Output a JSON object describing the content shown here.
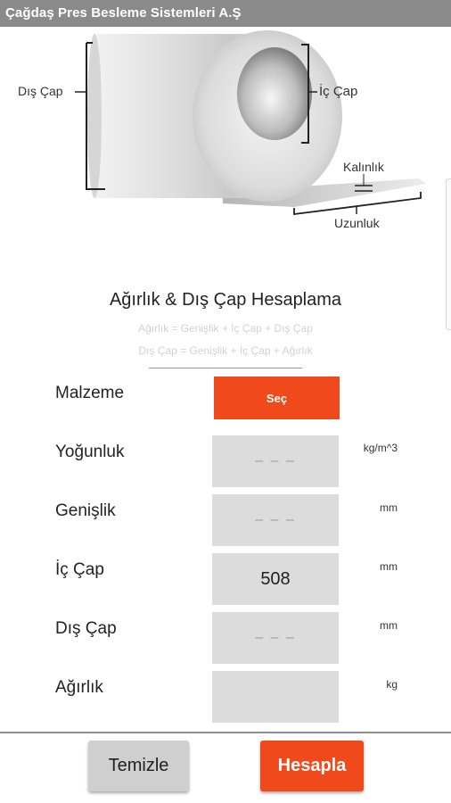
{
  "app": {
    "title": "Çağdaş Pres Besleme Sistemleri A.Ş"
  },
  "diagram": {
    "outer_diameter_label": "Dış Çap",
    "inner_diameter_label": "İç Çap",
    "thickness_label": "Kalınlık",
    "length_label": "Uzunluk"
  },
  "section": {
    "title": "Ağırlık & Dış Çap Hesaplama",
    "formula_1": "Ağırlık = Genişlik + İç Çap + Dış Çap",
    "formula_2": "Dış Çap = Genişlik + İç Çap + Ağırlık"
  },
  "form": {
    "material": {
      "label": "Malzeme",
      "button": "Seç"
    },
    "density": {
      "label": "Yoğunluk",
      "value": "",
      "placeholder": "– – –",
      "unit": "kg/m^3"
    },
    "width": {
      "label": "Genişlik",
      "value": "",
      "placeholder": "– – –",
      "unit": "mm"
    },
    "inner_diameter": {
      "label": "İç Çap",
      "value": "508",
      "placeholder": "– – –",
      "unit": "mm"
    },
    "outer_diameter": {
      "label": "Dış Çap",
      "value": "",
      "placeholder": "– – –",
      "unit": "mm"
    },
    "weight": {
      "label": "Ağırlık",
      "value": "",
      "placeholder": "",
      "unit": "kg"
    }
  },
  "actions": {
    "clear": "Temizle",
    "calculate": "Hesapla"
  },
  "colors": {
    "accent": "#f04a1c",
    "appbar": "#8a8a8a",
    "field": "#dcdcdc",
    "clear_button": "#cfcfcf"
  }
}
